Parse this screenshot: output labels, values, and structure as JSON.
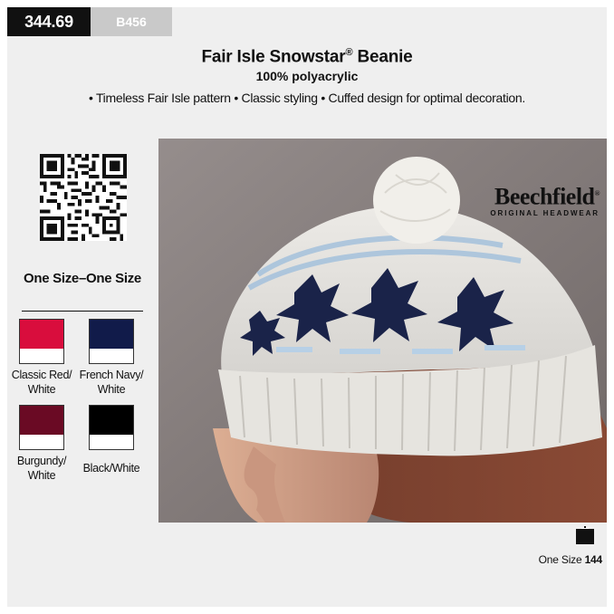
{
  "price": "344.69",
  "sku": "B456",
  "product": {
    "title": "Fair Isle Snowstar",
    "registered_mark": "®",
    "title_suffix": " Beanie",
    "material": "100% polyacrylic",
    "bullets": "• Timeless Fair Isle pattern • Classic styling • Cuffed design for optimal decoration."
  },
  "qr": {
    "icon": "qr-code"
  },
  "sizes": {
    "heading": "One Size–One Size"
  },
  "colors": [
    {
      "label_line1": "Classic Red/",
      "label_line2": "White",
      "swatch": "#d90d3d"
    },
    {
      "label_line1": "French Navy/",
      "label_line2": "White",
      "swatch": "#111b4a"
    },
    {
      "label_line1": "Burgundy/",
      "label_line2": "White",
      "swatch": "#6a0a24"
    },
    {
      "label_line1": "Black/White",
      "label_line2": "",
      "swatch": "#000000"
    }
  ],
  "brand": {
    "name": "Beechfield",
    "registered_mark": "®",
    "tagline": "ORIGINAL HEADWEAR"
  },
  "size_chart": {
    "icon": "box-icon",
    "label": "One Size",
    "count": "144"
  },
  "palette": {
    "price_bg": "#111111",
    "sku_bg": "#c9c9c9",
    "page_bg": "#efefef",
    "photo_bg": "#7d7675"
  }
}
